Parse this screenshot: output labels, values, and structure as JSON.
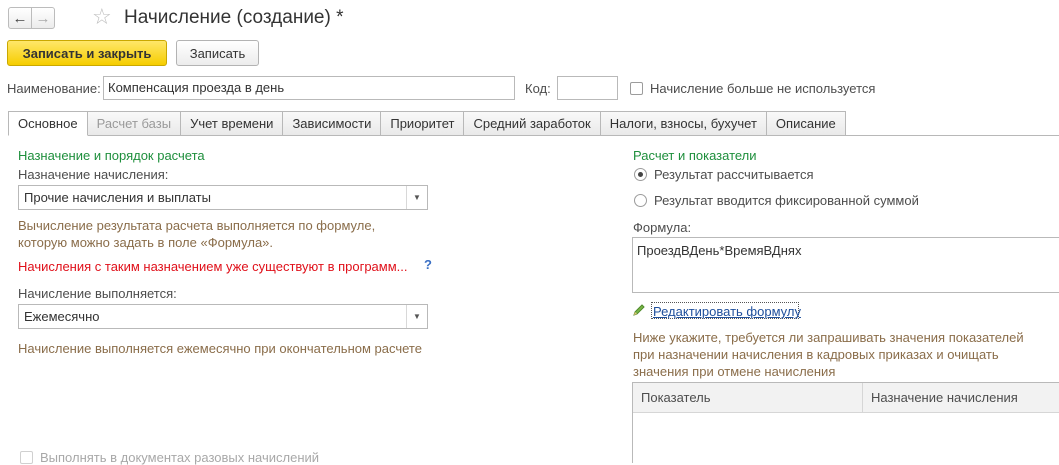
{
  "window": {
    "title": "Начисление (создание) *",
    "back_icon": "←",
    "forward_icon": "→",
    "favorite_icon": "☆"
  },
  "toolbar": {
    "save_close_label": "Записать и закрыть",
    "save_label": "Записать"
  },
  "header": {
    "name_label": "Наименование:",
    "name_value": "Компенсация проезда в день",
    "code_label": "Код:",
    "code_value": "",
    "not_used_label": "Начисление больше не используется"
  },
  "tabs": [
    {
      "label": "Основное",
      "state": "active"
    },
    {
      "label": "Расчет базы",
      "state": "disabled"
    },
    {
      "label": "Учет времени",
      "state": "normal"
    },
    {
      "label": "Зависимости",
      "state": "normal"
    },
    {
      "label": "Приоритет",
      "state": "normal"
    },
    {
      "label": "Средний заработок",
      "state": "normal"
    },
    {
      "label": "Налоги, взносы, бухучет",
      "state": "normal"
    },
    {
      "label": "Описание",
      "state": "normal"
    }
  ],
  "left": {
    "group_title": "Назначение и порядок расчета",
    "purpose_label": "Назначение начисления:",
    "purpose_value": "Прочие начисления и выплаты",
    "purpose_note_line1": "Вычисление результата расчета выполняется по формуле,",
    "purpose_note_line2": "которую можно задать в поле «Формула».",
    "warning": "Начисления с таким назначением уже существуют в программ...",
    "help_label": "?",
    "executes_label": "Начисление выполняется:",
    "executes_value": "Ежемесячно",
    "executes_note": "Начисление выполняется ежемесячно при окончательном расчете",
    "one_time_docs_label": "Выполнять в документах разовых начислений"
  },
  "right": {
    "group_title": "Расчет и показатели",
    "radio_calculated": "Результат рассчитывается",
    "radio_fixed": "Результат вводится фиксированной суммой",
    "formula_label": "Формула:",
    "formula_value": "ПроездВДень*ВремяВДнях",
    "edit_formula_link": "Редактировать формулу",
    "indicators_note_line1": "Ниже укажите, требуется ли запрашивать значения показателей",
    "indicators_note_line2": "при назначении начисления в кадровых приказах и очищать",
    "indicators_note_line3": "значения при отмене начисления",
    "table_columns": [
      "Показатель",
      "Назначение начисления"
    ]
  },
  "colors": {
    "accent_yellow": "#f6cd00",
    "group_green": "#1e8f3c",
    "note_brown": "#8a6d4a",
    "warning_red": "#e0101a",
    "link_blue": "#1f4f9c"
  }
}
